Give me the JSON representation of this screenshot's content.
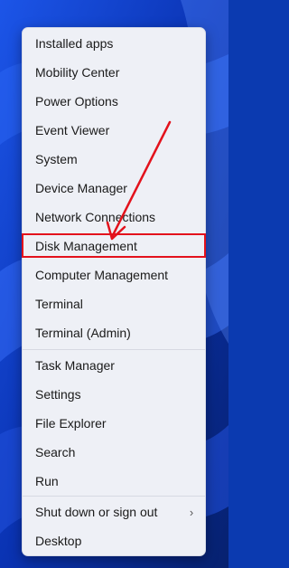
{
  "menu": {
    "group1": [
      {
        "id": "installed-apps",
        "label": "Installed apps"
      },
      {
        "id": "mobility-center",
        "label": "Mobility Center"
      },
      {
        "id": "power-options",
        "label": "Power Options"
      },
      {
        "id": "event-viewer",
        "label": "Event Viewer"
      },
      {
        "id": "system",
        "label": "System"
      },
      {
        "id": "device-manager",
        "label": "Device Manager"
      },
      {
        "id": "network-connections",
        "label": "Network Connections"
      },
      {
        "id": "disk-management",
        "label": "Disk Management"
      },
      {
        "id": "computer-management",
        "label": "Computer Management"
      },
      {
        "id": "terminal",
        "label": "Terminal"
      },
      {
        "id": "terminal-admin",
        "label": "Terminal (Admin)"
      }
    ],
    "group2": [
      {
        "id": "task-manager",
        "label": "Task Manager"
      },
      {
        "id": "settings",
        "label": "Settings"
      },
      {
        "id": "file-explorer",
        "label": "File Explorer"
      },
      {
        "id": "search",
        "label": "Search"
      },
      {
        "id": "run",
        "label": "Run"
      }
    ],
    "group3": [
      {
        "id": "shut-down-or-sign-out",
        "label": "Shut down or sign out",
        "submenu_icon": "chevron-right-icon",
        "submenu_glyph": "›"
      },
      {
        "id": "desktop",
        "label": "Desktop"
      }
    ]
  },
  "annotation": {
    "highlighted_item": "Disk Management",
    "highlight_color": "#e3121c",
    "arrow_color": "#e3121c"
  },
  "colors": {
    "menu_bg": "#eef0f6",
    "wallpaper_primary": "#0b3ab0"
  }
}
